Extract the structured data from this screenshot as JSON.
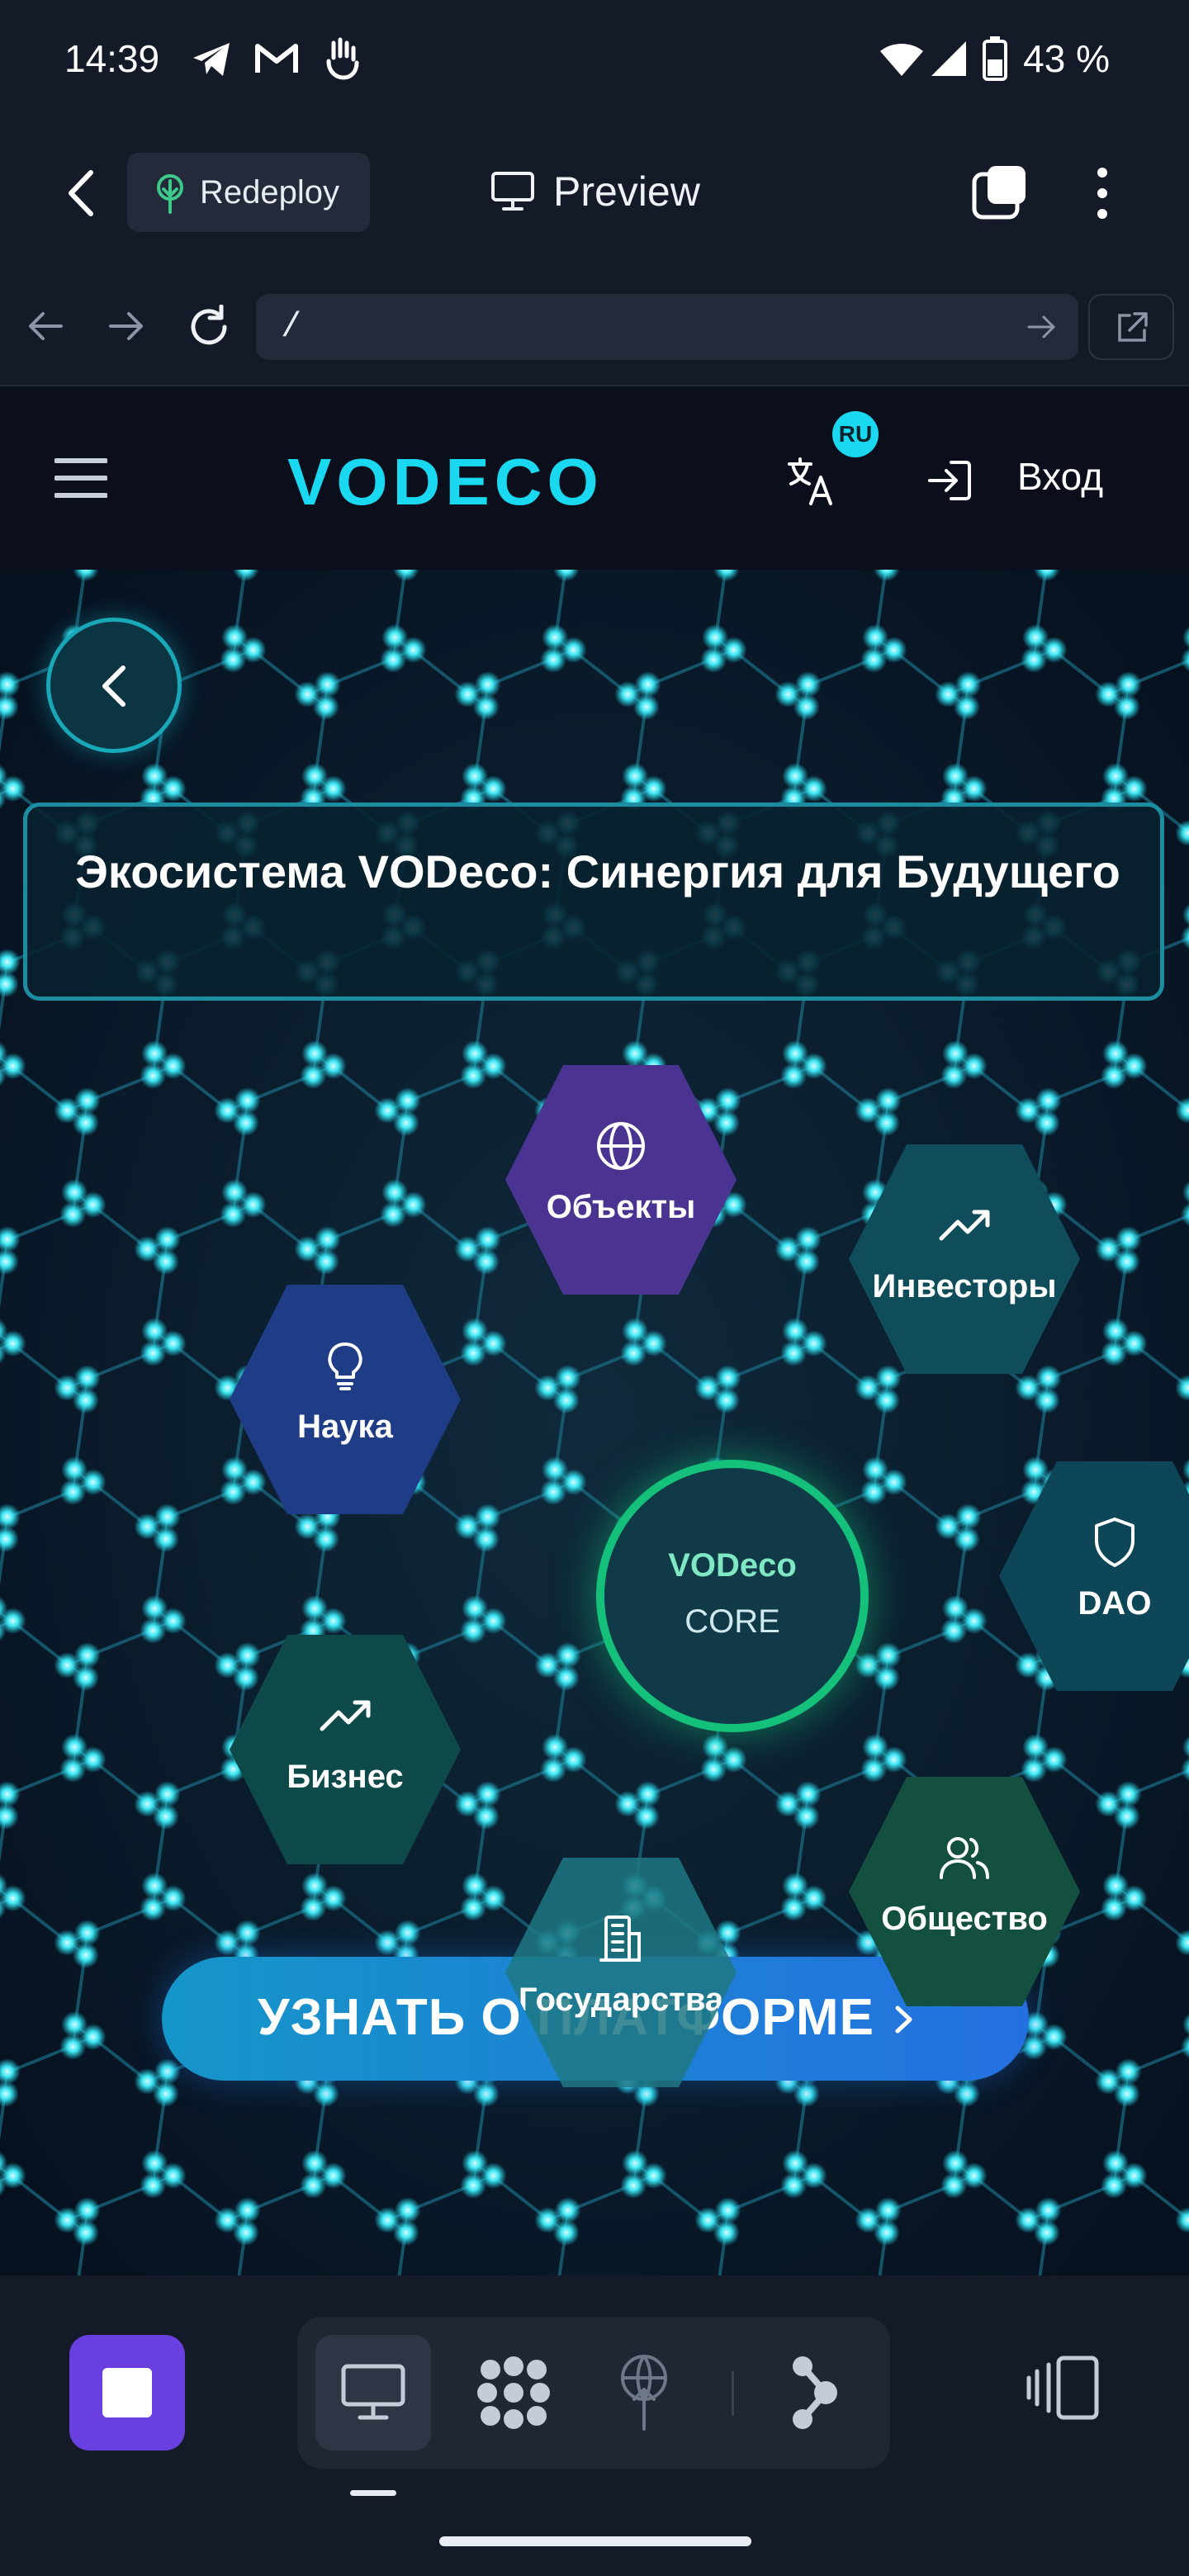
{
  "status_bar": {
    "time": "14:39",
    "battery": "43 %"
  },
  "browser_bar": {
    "redeploy_label": "Redeploy",
    "preview_label": "Preview",
    "url": "/"
  },
  "site_header": {
    "logo": "VODECO",
    "language_badge": "RU",
    "login_label": "Вход"
  },
  "hero": {
    "title": "Экосистема VODeco: Синергия для Будущего",
    "nodes": [
      {
        "label": "Объекты",
        "icon": "globe-icon",
        "color": "#4a3391"
      },
      {
        "label": "Инвесторы",
        "icon": "trending-up-icon",
        "color": "#0f4d5a"
      },
      {
        "label": "Наука",
        "icon": "lightbulb-icon",
        "color": "#1f3c86"
      },
      {
        "label": "DAO",
        "icon": "shield-icon",
        "color": "#0d4657"
      },
      {
        "label": "Бизнес",
        "icon": "trending-up-icon",
        "color": "#0f4a4a"
      },
      {
        "label": "Общество",
        "icon": "users-icon",
        "color": "#145040"
      },
      {
        "label": "Государства",
        "icon": "building-icon",
        "color": "#1f6b78"
      }
    ],
    "core_line1": "VODeco",
    "core_line2": "CORE",
    "cta_label": "УЗНАТЬ О ПЛАТФОРМЕ"
  },
  "colors": {
    "accent": "#19d8ef",
    "purple": "#6a3fe0",
    "green": "#14c07a"
  }
}
